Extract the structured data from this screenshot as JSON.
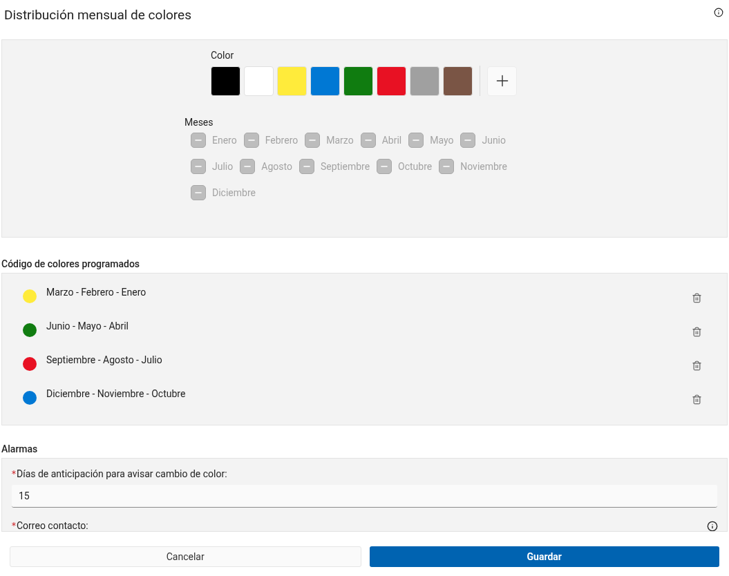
{
  "header": {
    "title": "Distribución mensual de colores"
  },
  "color_picker": {
    "label": "Color",
    "swatches": [
      {
        "color": "#000000"
      },
      {
        "color": "#ffffff"
      },
      {
        "color": "#ffeb3b"
      },
      {
        "color": "#0078d4"
      },
      {
        "color": "#107c10"
      },
      {
        "color": "#e81123"
      },
      {
        "color": "#a0a0a0"
      },
      {
        "color": "#7a5545"
      }
    ]
  },
  "months": {
    "label": "Meses",
    "items": [
      {
        "label": "Enero",
        "disabled": true
      },
      {
        "label": "Febrero",
        "disabled": true
      },
      {
        "label": "Marzo",
        "disabled": true
      },
      {
        "label": "Abril",
        "disabled": true
      },
      {
        "label": "Mayo",
        "disabled": true
      },
      {
        "label": "Junio",
        "disabled": true
      },
      {
        "label": "Julio",
        "disabled": true
      },
      {
        "label": "Agosto",
        "disabled": true
      },
      {
        "label": "Septiembre",
        "disabled": true
      },
      {
        "label": "Octubre",
        "disabled": true
      },
      {
        "label": "Noviembre",
        "disabled": true
      },
      {
        "label": "Diciembre",
        "disabled": true
      }
    ]
  },
  "scheduled": {
    "title": "Código de colores programados",
    "rows": [
      {
        "label": "Marzo - Febrero - Enero",
        "color": "#ffeb3b"
      },
      {
        "label": "Junio - Mayo - Abril",
        "color": "#107c10"
      },
      {
        "label": "Septiembre - Agosto - Julio",
        "color": "#e81123"
      },
      {
        "label": "Diciembre - Noviembre - Octubre",
        "color": "#0078d4"
      }
    ]
  },
  "alarms": {
    "title": "Alarmas",
    "fields": [
      {
        "kind": "input",
        "label": "Días de anticipación para avisar cambio de color:",
        "required": true,
        "value": "15"
      },
      {
        "kind": "label",
        "label": "Correo contacto:",
        "required": true
      }
    ]
  },
  "footer": {
    "buttons": [
      {
        "label": "Cancelar",
        "kind": "secondary"
      },
      {
        "label": "Guardar",
        "kind": "primary"
      }
    ]
  }
}
